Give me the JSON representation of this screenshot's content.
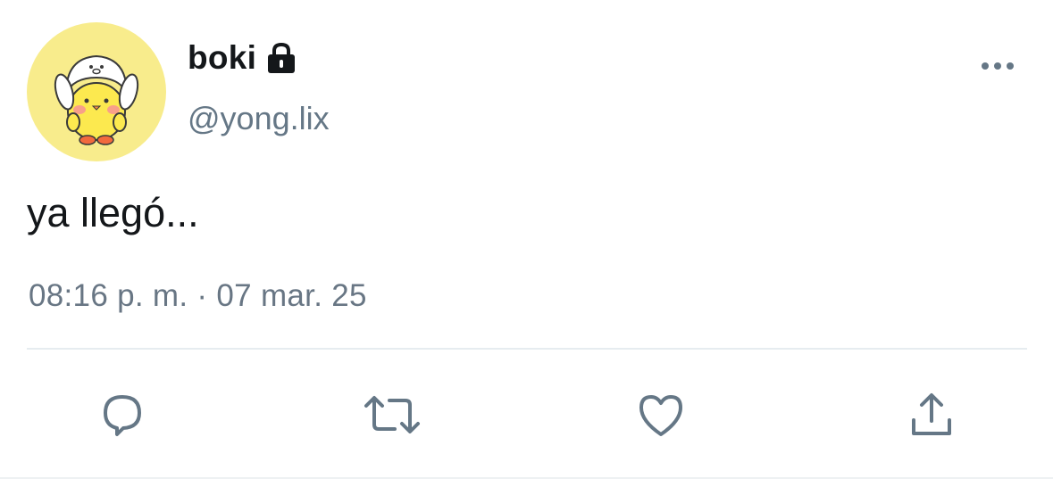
{
  "tweet": {
    "display_name": "boki",
    "handle": "@yong.lix",
    "text": "ya llegó...",
    "timestamp": "08:16 p. m. · 07 mar. 25",
    "protected": true
  },
  "icons": {
    "lock": "lock-icon",
    "more": "more-horizontal-icon",
    "reply": "reply-icon",
    "retweet": "retweet-icon",
    "like": "heart-icon",
    "share": "share-icon"
  },
  "colors": {
    "text_primary": "#14171a",
    "text_secondary": "#657786",
    "icon": "#657786",
    "avatar_bg": "#f8ec8c",
    "divider": "#e6ecf0"
  }
}
